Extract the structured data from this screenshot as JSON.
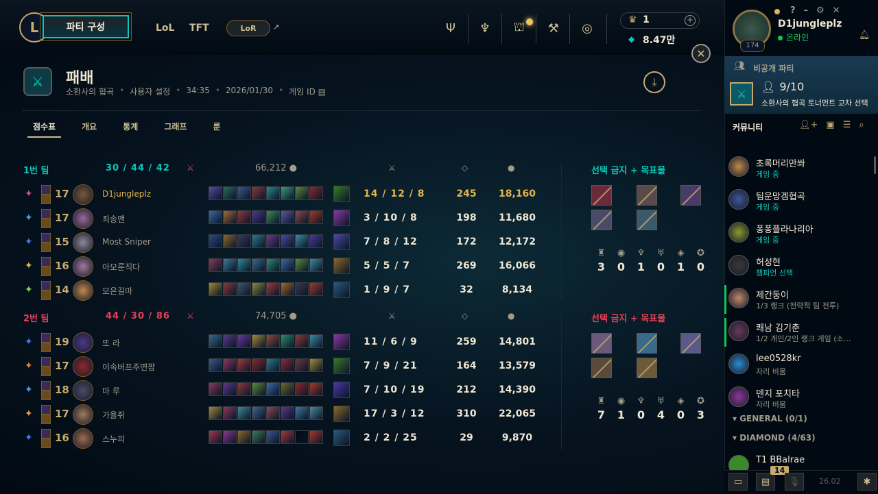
{
  "colors": {
    "gold": "#c8aa6e",
    "teal": "#0ac8b9",
    "blue_team": "#0ac8b9",
    "red_team": "#e84057",
    "highlight": "#e2b64a"
  },
  "topnav": {
    "party_label": "파티 구성",
    "links": [
      "LoL",
      "TFT"
    ],
    "lor_label": "LoR",
    "rp": "1",
    "be": "8.47만"
  },
  "match": {
    "title": "패배",
    "mode": "소환사의 협곡",
    "type": "사용자 설정",
    "duration": "34:35",
    "date": "2026/01/30",
    "game_id_label": "게임 ID",
    "tabs": [
      "점수표",
      "개요",
      "통계",
      "그래프",
      "룬"
    ]
  },
  "teams": [
    {
      "name": "1번 팀",
      "kills": "30",
      "deaths": "44",
      "assists": "42",
      "gold": "66,212",
      "objectives_title": "선택 금지 + 목표물",
      "objectives": [
        "3",
        "0",
        "1",
        "0",
        "1",
        "0"
      ],
      "players": [
        {
          "level": "17",
          "name": "D1jungleplz",
          "kda": "14 / 12 / 8",
          "cs": "245",
          "gold": "18,160",
          "me": true,
          "rune_color": "#d94a8a",
          "champ_color": "#7a5a3a",
          "items": [
            "#5a4aa0",
            "#2a6a5a",
            "#3a5a8a",
            "#8a3a3a",
            "#2a8a8a",
            "#3a9a7a",
            "#5a8a3a",
            "#8a2a2a"
          ],
          "trinket": "#3a7a2a"
        },
        {
          "level": "17",
          "name": "죄송맨",
          "kda": "3 / 10 / 8",
          "cs": "198",
          "gold": "11,680",
          "me": false,
          "rune_color": "#4aa0e0",
          "champ_color": "#9a6a9a",
          "items": [
            "#3a6aa0",
            "#a06a3a",
            "#8a3a3a",
            "#4a3a8a",
            "#3a8a5a",
            "#5a5aa0",
            "#8a4a4a",
            "#a03a2a"
          ],
          "trinket": "#8a3aa0"
        },
        {
          "level": "15",
          "name": "Most Sniper",
          "kda": "7 / 8 / 12",
          "cs": "172",
          "gold": "12,172",
          "me": false,
          "rune_color": "#4a7ae0",
          "champ_color": "#8a8a9a",
          "items": [
            "#2a4a8a",
            "#8a6a2a",
            "#3a3a5a",
            "#2a7a8a",
            "#6a3a8a",
            "#4a4a9a",
            "#3a8aa0",
            "#4a3a9a"
          ],
          "trinket": "#4a4aa0"
        },
        {
          "level": "16",
          "name": "아모룬직다",
          "kda": "5 / 5 / 7",
          "cs": "269",
          "gold": "16,066",
          "me": false,
          "rune_color": "#e2b64a",
          "champ_color": "#a07a9a",
          "items": [
            "#8a3a5a",
            "#3a7a9a",
            "#2a8a9a",
            "#3a6a8a",
            "#2a8a7a",
            "#3a6aa0",
            "#5a8a3a",
            "#3a8aa0"
          ],
          "trinket": "#8a6a2a"
        },
        {
          "level": "14",
          "name": "모은길마",
          "kda": "1 / 9 / 7",
          "cs": "32",
          "gold": "8,134",
          "me": false,
          "rune_color": "#8ad04a",
          "champ_color": "#c08a4a",
          "items": [
            "#a08a2a",
            "#8a3a3a",
            "#3a5a6a",
            "#8a8a3a",
            "#a03a3a",
            "#a06a2a",
            "#3a3a4a",
            "#a03a2a"
          ],
          "trinket": "#2a5a7a"
        }
      ]
    },
    {
      "name": "2번 팀",
      "kills": "44",
      "deaths": "30",
      "assists": "86",
      "gold": "74,705",
      "objectives_title": "선택 금지 + 목표물",
      "objectives": [
        "7",
        "1",
        "0",
        "4",
        "0",
        "3"
      ],
      "players": [
        {
          "level": "19",
          "name": "또 라",
          "kda": "11 / 6 / 9",
          "cs": "259",
          "gold": "14,801",
          "me": false,
          "rune_color": "#4a7ae0",
          "champ_color": "#4a3a8a",
          "items": [
            "#3a6a8a",
            "#5a3a8a",
            "#6a3a9a",
            "#a08a3a",
            "#8a4a3a",
            "#2a8a6a",
            "#8a3a3a",
            "#3a8aa0"
          ],
          "trinket": "#8a3aa0"
        },
        {
          "level": "17",
          "name": "이속버프주면팜",
          "kda": "7 / 9 / 21",
          "cs": "164",
          "gold": "13,579",
          "me": false,
          "rune_color": "#e28a2a",
          "champ_color": "#8a2a2a",
          "items": [
            "#3a5a8a",
            "#8a3a5a",
            "#a03a3a",
            "#8a2a2a",
            "#2a7a8a",
            "#8a2a3a",
            "#6a3a3a",
            "#a08a3a"
          ],
          "trinket": "#3a7a2a"
        },
        {
          "level": "18",
          "name": "마 루",
          "kda": "7 / 10 / 19",
          "cs": "212",
          "gold": "14,390",
          "me": false,
          "rune_color": "#4aa0e0",
          "champ_color": "#4a4a6a",
          "items": [
            "#8a3a5a",
            "#5a3a8a",
            "#8a3a3a",
            "#5a8a3a",
            "#3a6aa0",
            "#6a6a2a",
            "#8a2a2a",
            "#a03a2a"
          ],
          "trinket": "#4a3aa0"
        },
        {
          "level": "17",
          "name": "가을쥐",
          "kda": "17 / 3 / 12",
          "cs": "310",
          "gold": "22,065",
          "me": false,
          "rune_color": "#e2a04a",
          "champ_color": "#a07a5a",
          "items": [
            "#a08a3a",
            "#8a3a5a",
            "#3a8a9a",
            "#3a6a8a",
            "#8a4a5a",
            "#5a3a8a",
            "#3a7aa0",
            "#4a8aa0"
          ],
          "trinket": "#8a6a2a"
        },
        {
          "level": "16",
          "name": "스누피",
          "kda": "2 / 2 / 25",
          "cs": "29",
          "gold": "9,870",
          "me": false,
          "rune_color": "#4a7ae0",
          "champ_color": "#a06a4a",
          "items": [
            "#a03a4a",
            "#8a3a8a",
            "#8a6a2a",
            "#3a7a5a",
            "#3a5a8a",
            "#a03a3a",
            "#010a13",
            "#a03a2a"
          ],
          "trinket": "#2a5a7a"
        }
      ]
    }
  ],
  "social": {
    "profile_level": "174",
    "summoner_name": "D1jungleplz",
    "status": "온라인",
    "lobby_label": "비공개 파티",
    "lobby_count": "9/10",
    "lobby_mode": "소환사의 협곡 토너먼트 교차 선택",
    "community_label": "커뮤니티",
    "friends": [
      {
        "name": "초록머리만쏴",
        "status": "게임 중",
        "kind": "ingame",
        "color": "#c08a4a"
      },
      {
        "name": "팀운망겜협곡",
        "status": "게임 중",
        "kind": "ingame",
        "color": "#3a5a9a"
      },
      {
        "name": "퐁퐁플라나리아",
        "status": "게임 중",
        "kind": "ingame",
        "color": "#8a9a2a"
      },
      {
        "name": "허성현",
        "status": "챔피언 선택",
        "kind": "ingame",
        "color": "#3a3a3a"
      },
      {
        "name": "제간둥이",
        "status": "1/3 랭크 (전략적 팀 전투)",
        "kind": "ranked",
        "color": "#c08a6a"
      },
      {
        "name": "쾌남 김기춘",
        "status": "1/2 개인/2인 랭크 게임 (소…",
        "kind": "ranked",
        "color": "#6a3a5a"
      },
      {
        "name": "lee0528kr",
        "status": "자리 비움",
        "kind": "away",
        "color": "#2a8ad0"
      },
      {
        "name": "덴지 포치타",
        "status": "자리 비움",
        "kind": "away",
        "color": "#8a3a9a"
      }
    ],
    "groups": [
      "GENERAL (0/1)",
      "DIAMOND (4/63)"
    ],
    "last_friend": "T1 BBalrae",
    "badge_count": "14",
    "version": "26.02"
  }
}
